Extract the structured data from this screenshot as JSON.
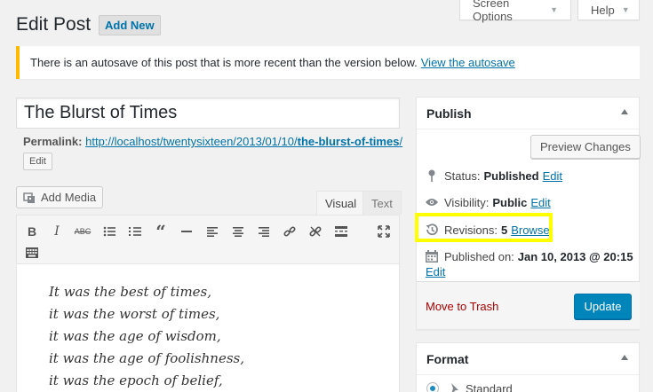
{
  "header": {
    "screen_options": "Screen Options",
    "help": "Help",
    "page_title": "Edit Post",
    "add_new": "Add New"
  },
  "notice": {
    "text": "There is an autosave of this post that is more recent than the version below.",
    "link": "View the autosave"
  },
  "post": {
    "title": "The Blurst of Times",
    "permalink_label": "Permalink:",
    "permalink_base": "http://localhost/twentysixteen/2013/01/10/",
    "permalink_slug": "the-blurst-of-times",
    "permalink_end": "/",
    "edit_slug": "Edit"
  },
  "editor": {
    "add_media": "Add Media",
    "tab_visual": "Visual",
    "tab_text": "Text",
    "lines": [
      "It was the best of times,",
      "it was the worst of times,",
      "it was the age of wisdom,",
      "it was the age of foolishness,",
      "it was the epoch of belief,"
    ]
  },
  "publish": {
    "title": "Publish",
    "preview": "Preview Changes",
    "status_label": "Status:",
    "status_value": "Published",
    "visibility_label": "Visibility:",
    "visibility_value": "Public",
    "revisions_label": "Revisions:",
    "revisions_value": "5",
    "browse": "Browse",
    "published_label": "Published on:",
    "published_value": "Jan 10, 2013 @ 20:15",
    "edit": "Edit",
    "trash": "Move to Trash",
    "update": "Update"
  },
  "format": {
    "title": "Format",
    "selected": "Standard"
  },
  "colors": {
    "accent": "#0073aa",
    "primary_button": "#0085ba",
    "notice_border": "#ffb900",
    "highlight": "#ffff00",
    "trash": "#aa0000"
  }
}
